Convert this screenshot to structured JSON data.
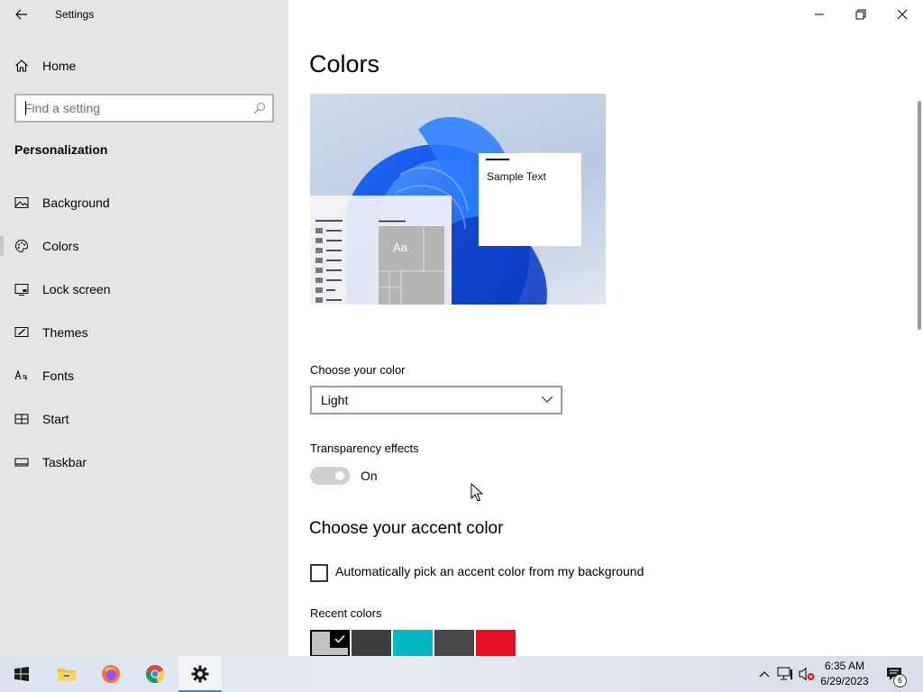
{
  "window": {
    "app_title": "Settings",
    "back_icon": "back-arrow-icon",
    "controls": [
      "minimize-icon",
      "restore-icon",
      "close-icon"
    ]
  },
  "sidebar": {
    "home_label": "Home",
    "search_placeholder": "Find a setting",
    "section_title": "Personalization",
    "items": [
      {
        "label": "Background",
        "icon": "picture-icon"
      },
      {
        "label": "Colors",
        "icon": "palette-icon",
        "selected": true
      },
      {
        "label": "Lock screen",
        "icon": "lock-screen-icon"
      },
      {
        "label": "Themes",
        "icon": "themes-icon"
      },
      {
        "label": "Fonts",
        "icon": "fonts-icon"
      },
      {
        "label": "Start",
        "icon": "start-icon"
      },
      {
        "label": "Taskbar",
        "icon": "taskbar-icon"
      }
    ]
  },
  "main": {
    "title": "Colors",
    "preview": {
      "sample_text": "Sample Text",
      "tile_text": "Aa"
    },
    "choose_color_label": "Choose your color",
    "choose_color_value": "Light",
    "transparency_label": "Transparency effects",
    "transparency_state": "On",
    "transparency_on": true,
    "accent_title": "Choose your accent color",
    "auto_pick_label": "Automatically pick an accent color from my background",
    "auto_pick_checked": false,
    "recent_colors_label": "Recent colors",
    "recent_colors": [
      "#c2c2c2",
      "#3d3d3d",
      "#00b8c4",
      "#484848",
      "#e81123"
    ],
    "selected_recent_color": 0
  },
  "taskbar": {
    "apps": [
      "windows-start-icon",
      "file-explorer-icon",
      "firefox-icon",
      "chrome-icon",
      "settings-gear-icon"
    ],
    "active_app": "settings-gear-icon",
    "time": "6:35 AM",
    "date": "6/29/2023",
    "notification_count": "6"
  },
  "colors": {
    "sidebar_bg": "#e6e6e6",
    "toggle_on": "#cfcfcf",
    "red": "#e81123",
    "teal": "#00b8c4"
  }
}
